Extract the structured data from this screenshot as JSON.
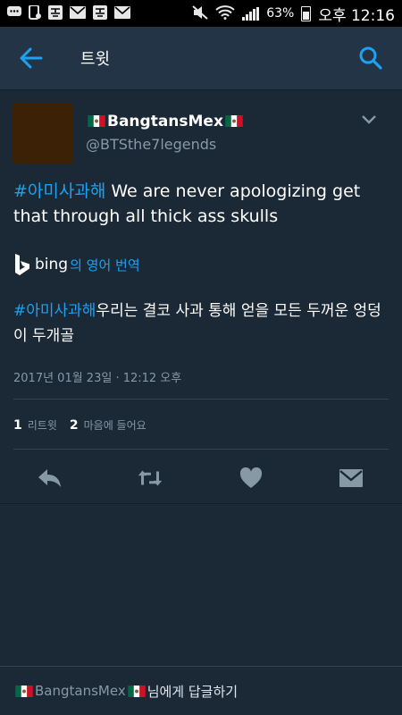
{
  "status_bar": {
    "battery": "63%",
    "time": "오후 12:16",
    "icons": [
      "chat-icon",
      "mobile-icon",
      "pick-icon",
      "mail-icon",
      "pick-icon",
      "mail-icon",
      "mute-icon",
      "wifi-icon",
      "signal-icon",
      "battery-icon"
    ]
  },
  "app_bar": {
    "title": "트윗",
    "back_icon": "arrow-left-icon",
    "search_icon": "search-icon",
    "accent": "#1da1f2"
  },
  "tweet": {
    "display_name": "BangtansMex",
    "handle": "@BTSthe7legends",
    "hashtag": "#아미사과해",
    "text": " We are never apologizing get that through all thick ass skulls",
    "translation_provider": "bing",
    "translation_label": "의 영어 번역",
    "translated_hashtag": "#아미사과해",
    "translated_text": "우리는 결코 사과 통해 얻을 모든 두꺼운 엉덩이 두개골",
    "timestamp": "2017년 01월 23일 · 12:12 오후",
    "retweets": {
      "count": "1",
      "label": "리트윗"
    },
    "likes": {
      "count": "2",
      "label": "마음에 들어요"
    }
  },
  "actions": [
    "reply-icon",
    "retweet-icon",
    "heart-icon",
    "message-icon"
  ],
  "reply_bar": {
    "name": "BangtansMex",
    "suffix": " 님에게 답글하기"
  },
  "colors": {
    "background": "#1b2836",
    "app_bar": "#243447",
    "muted": "#8899a6",
    "accent": "#1da1f2"
  }
}
